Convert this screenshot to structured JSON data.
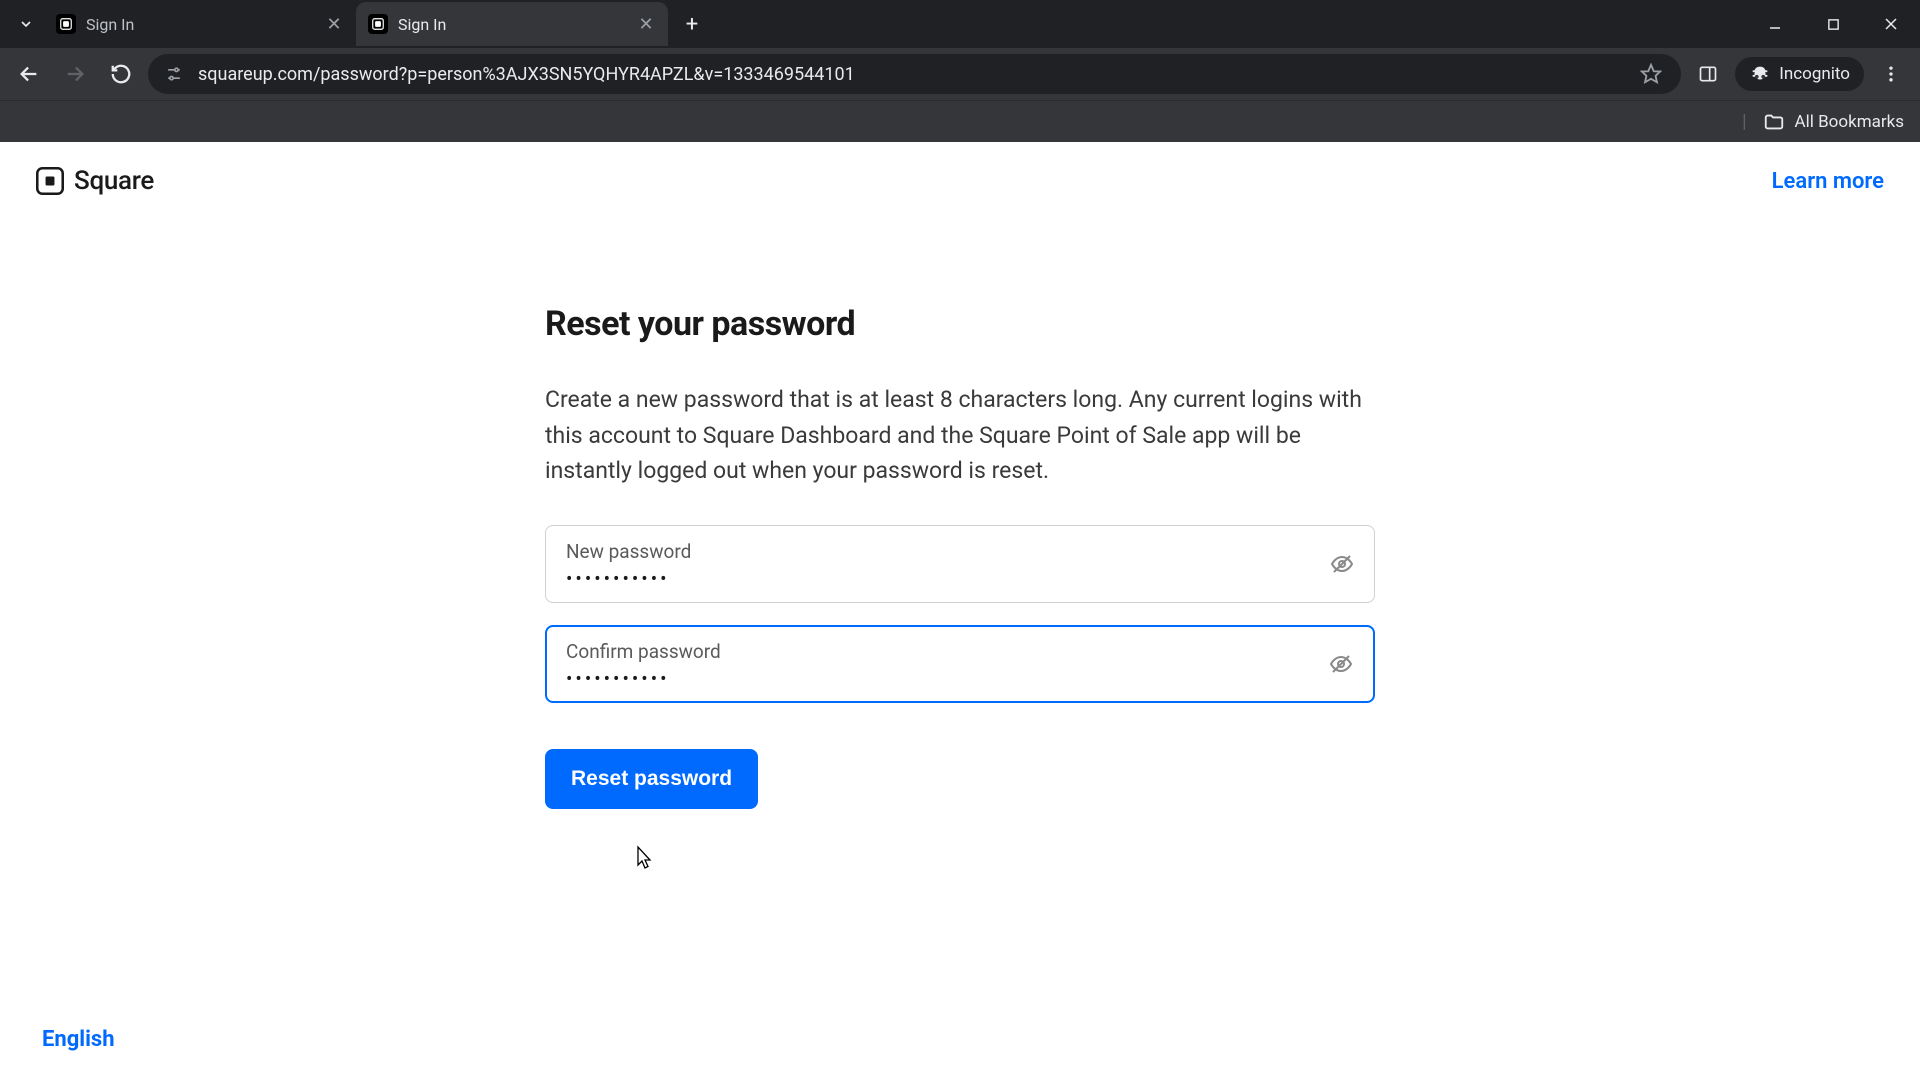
{
  "browser": {
    "tabs": [
      {
        "title": "Sign In",
        "active": false
      },
      {
        "title": "Sign In",
        "active": true
      }
    ],
    "url": "squareup.com/password?p=person%3AJX3SN5YQHYR4APZL&v=1333469544101",
    "incognito_label": "Incognito",
    "all_bookmarks": "All Bookmarks"
  },
  "header": {
    "brand": "Square",
    "learn_more": "Learn more"
  },
  "form": {
    "heading": "Reset your password",
    "body": "Create a new password that is at least 8 characters long. Any current logins with this account to Square Dashboard and the Square Point of Sale app will be instantly logged out when your password is reset.",
    "new_password_label": "New password",
    "new_password_value": "•••••••••••",
    "confirm_password_label": "Confirm password",
    "confirm_password_value": "•••••••••••",
    "submit_label": "Reset password"
  },
  "footer": {
    "language": "English"
  }
}
